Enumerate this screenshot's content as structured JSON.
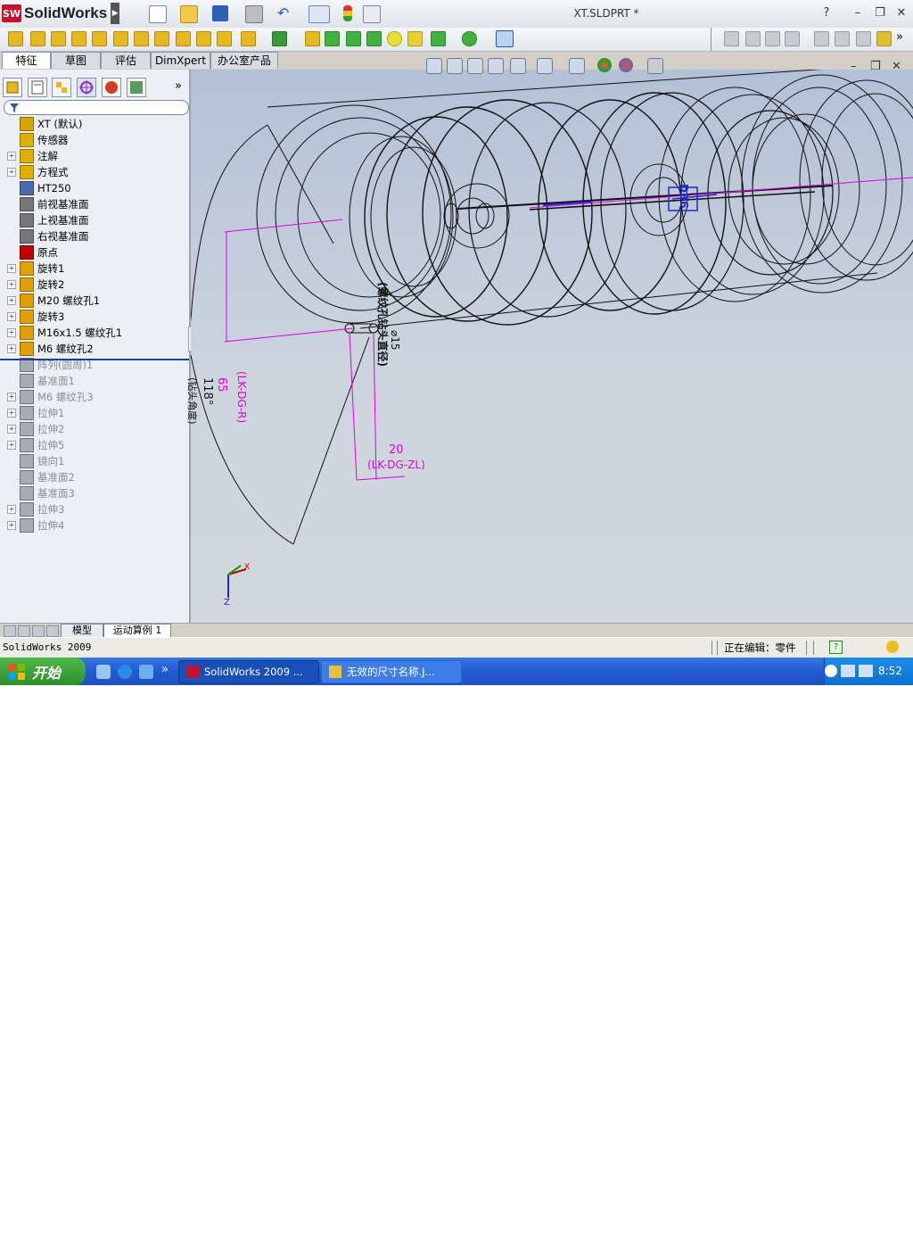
{
  "app": {
    "logo_text": "SolidWorks",
    "logo_badge": "SW",
    "document_title": "XT.SLDPRT *",
    "help_label": "?",
    "window_buttons": [
      "–",
      "❐",
      "✕"
    ]
  },
  "command_tabs": [
    {
      "label": "特征",
      "active": true
    },
    {
      "label": "草图",
      "active": false
    },
    {
      "label": "评估",
      "active": false
    },
    {
      "label": "DimXpert",
      "active": false
    },
    {
      "label": "办公室产品",
      "active": false
    }
  ],
  "panel": {
    "expand_label": "»",
    "collapse_label": "‹"
  },
  "tree": [
    {
      "label": "XT  (默认)",
      "icon": "part-icon",
      "color": "#d9a400",
      "expand": false,
      "gray": false
    },
    {
      "label": "传感器",
      "icon": "sensor-icon",
      "color": "#e0b000",
      "expand": false,
      "gray": false
    },
    {
      "label": "注解",
      "icon": "annotation-icon",
      "color": "#e0b000",
      "expand": true,
      "gray": false
    },
    {
      "label": "方程式",
      "icon": "equation-icon",
      "color": "#e0b000",
      "expand": true,
      "gray": false
    },
    {
      "label": "HT250",
      "icon": "material-icon",
      "color": "#4a6aa8",
      "expand": false,
      "gray": false
    },
    {
      "label": "前视基准面",
      "icon": "plane-icon",
      "color": "#777777",
      "expand": false,
      "gray": false
    },
    {
      "label": "上视基准面",
      "icon": "plane-icon",
      "color": "#777777",
      "expand": false,
      "gray": false
    },
    {
      "label": "右视基准面",
      "icon": "plane-icon",
      "color": "#777777",
      "expand": false,
      "gray": false
    },
    {
      "label": "原点",
      "icon": "origin-icon",
      "color": "#c00000",
      "expand": false,
      "gray": false
    },
    {
      "label": "旋转1",
      "icon": "revolve-icon",
      "color": "#e0a000",
      "expand": true,
      "gray": false
    },
    {
      "label": "旋转2",
      "icon": "revolve-icon",
      "color": "#e0a000",
      "expand": true,
      "gray": false
    },
    {
      "label": "M20 螺纹孔1",
      "icon": "hole-icon",
      "color": "#e0a000",
      "expand": true,
      "gray": false
    },
    {
      "label": "旋转3",
      "icon": "revolve-icon",
      "color": "#e0a000",
      "expand": true,
      "gray": false
    },
    {
      "label": "M16x1.5 螺纹孔1",
      "icon": "hole-icon",
      "color": "#e0a000",
      "expand": true,
      "gray": false
    },
    {
      "label": "M6 螺纹孔2",
      "icon": "hole-icon",
      "color": "#e0a000",
      "expand": true,
      "gray": false
    },
    {
      "label": "阵列(圆周)1",
      "icon": "pattern-icon",
      "color": "#a8acb3",
      "expand": false,
      "gray": true
    },
    {
      "label": "基准面1",
      "icon": "plane-icon",
      "color": "#a8acb3",
      "expand": false,
      "gray": true
    },
    {
      "label": "M6 螺纹孔3",
      "icon": "hole-icon",
      "color": "#a8acb3",
      "expand": true,
      "gray": true
    },
    {
      "label": "拉伸1",
      "icon": "extrude-icon",
      "color": "#a8acb3",
      "expand": true,
      "gray": true
    },
    {
      "label": "拉伸2",
      "icon": "extrude-icon",
      "color": "#a8acb3",
      "expand": true,
      "gray": true
    },
    {
      "label": "拉伸5",
      "icon": "extrude-icon",
      "color": "#a8acb3",
      "expand": true,
      "gray": true
    },
    {
      "label": "镜向1",
      "icon": "mirror-icon",
      "color": "#a8acb3",
      "expand": false,
      "gray": true
    },
    {
      "label": "基准面2",
      "icon": "plane-icon",
      "color": "#a8acb3",
      "expand": false,
      "gray": true
    },
    {
      "label": "基准面3",
      "icon": "plane-icon",
      "color": "#a8acb3",
      "expand": false,
      "gray": true
    },
    {
      "label": "拉伸3",
      "icon": "extrude-icon",
      "color": "#a8acb3",
      "expand": true,
      "gray": true
    },
    {
      "label": "拉伸4",
      "icon": "extrude-icon",
      "color": "#a8acb3",
      "expand": true,
      "gray": true
    }
  ],
  "drawing": {
    "dim_65": "65",
    "dim_65_name": "(LK-DG-R)",
    "dim_20": "20",
    "dim_20_name": "(LK-DG-ZL)",
    "angle_118": "118°",
    "angle_name": "(钻头角度)",
    "dia_label": "⌀15",
    "thread_name": "(螺纹孔钻头直径)",
    "hole_label": "DB6",
    "triad_axis": "Z",
    "triad_axis_x": "X",
    "magenta": "#e000e0",
    "blue": "#1a2ad0"
  },
  "bottom_tabs": [
    "模型",
    "运动算例 1"
  ],
  "status": {
    "left": "SolidWorks 2009",
    "right": "正在编辑：零件",
    "help": "?"
  },
  "taskbar": {
    "start": "开始",
    "tasks": [
      "SolidWorks 2009 ...",
      "无效的尺寸名称.J..."
    ],
    "quick_more": "»",
    "clock": "8:52"
  }
}
